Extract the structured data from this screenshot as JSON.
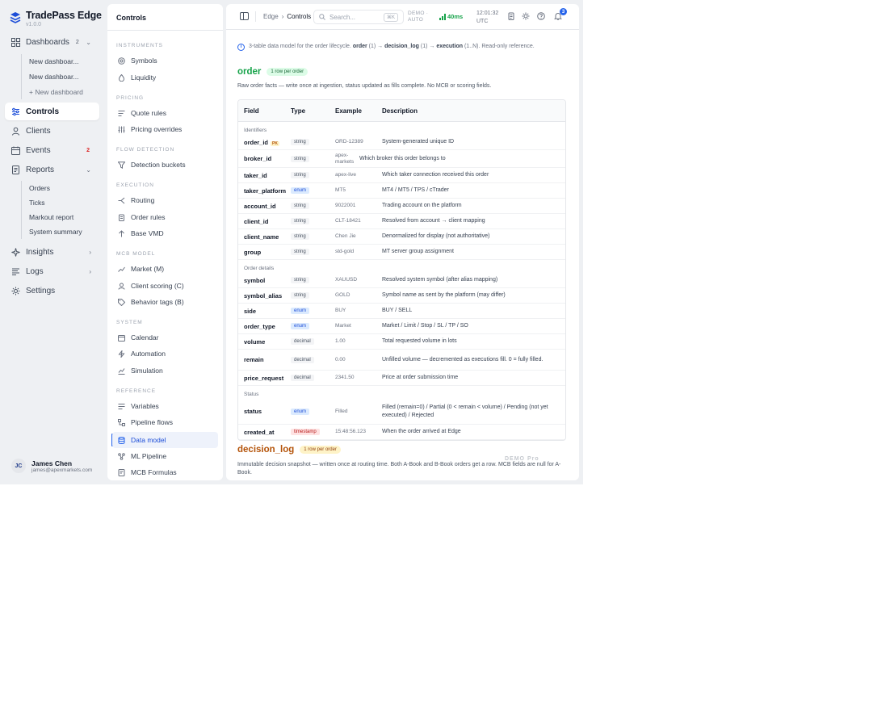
{
  "brand": {
    "name": "TradePass Edge",
    "version": "v1.0.0"
  },
  "sidebar": {
    "dashboards": {
      "label": "Dashboards",
      "count": "2"
    },
    "dashboard_items": [
      "New dashboar...",
      "New dashboar...",
      "+ New dashboard"
    ],
    "controls": {
      "label": "Controls"
    },
    "clients": {
      "label": "Clients"
    },
    "events": {
      "label": "Events",
      "count": "2"
    },
    "reports": {
      "label": "Reports"
    },
    "report_items": [
      "Orders",
      "Ticks",
      "Markout report",
      "System summary"
    ],
    "insights": {
      "label": "Insights"
    },
    "logs": {
      "label": "Logs"
    },
    "settings": {
      "label": "Settings"
    }
  },
  "user": {
    "initials": "JC",
    "name": "James Chen",
    "email": "james@apexmarkets.com"
  },
  "controls_panel": {
    "title": "Controls",
    "sections": {
      "instruments": "INSTRUMENTS",
      "pricing": "PRICING",
      "flow_detection": "FLOW DETECTION",
      "execution": "EXECUTION",
      "mcb_model": "MCB MODEL",
      "system": "SYSTEM",
      "reference": "REFERENCE"
    },
    "items": {
      "symbols": "Symbols",
      "liquidity": "Liquidity",
      "quote_rules": "Quote rules",
      "pricing_overrides": "Pricing overrides",
      "detection_buckets": "Detection buckets",
      "routing": "Routing",
      "order_rules": "Order rules",
      "base_vmd": "Base VMD",
      "market": "Market (M)",
      "client_scoring": "Client scoring (C)",
      "behavior_tags": "Behavior tags (B)",
      "calendar": "Calendar",
      "automation": "Automation",
      "simulation": "Simulation",
      "variables": "Variables",
      "pipeline_flows": "Pipeline flows",
      "data_model": "Data model",
      "ml_pipeline": "ML Pipeline",
      "mcb_formulas": "MCB Formulas"
    }
  },
  "topbar": {
    "crumb_root": "Edge",
    "crumb_sep": "›",
    "crumb_current": "Controls",
    "search_placeholder": "Search...",
    "search_kbd": "⌘K",
    "mode_line1": "DEMO ·",
    "mode_line2": "AUTO",
    "latency": "40ms",
    "time": "12:01:32",
    "timezone": "UTC",
    "notifications": "3"
  },
  "info": {
    "prefix": "3-table data model for the order lifecycle.",
    "t1": "order",
    "t1_card": "(1) →",
    "t2": "decision_log",
    "t2_card": "(1) →",
    "t3": "execution",
    "suffix": "(1..N). Read-only reference."
  },
  "order_section": {
    "title": "order",
    "pill": "1 row per order",
    "description": "Raw order facts — write once at ingestion, status updated as fills complete. No MCB or scoring fields.",
    "headers": {
      "field": "Field",
      "type": "Type",
      "example": "Example",
      "description": "Description"
    },
    "groups": {
      "identifiers": "Identifiers",
      "order_details": "Order details",
      "status": "Status"
    },
    "pk_label": "PK",
    "rows_identifiers": [
      {
        "field": "order_id",
        "type": "string",
        "example": "ORD-12389",
        "desc": "System-generated unique ID"
      },
      {
        "field": "broker_id",
        "type": "string",
        "example": "apex-markets",
        "desc": "Which broker this order belongs to"
      },
      {
        "field": "taker_id",
        "type": "string",
        "example": "apex-live",
        "desc": "Which taker connection received this order"
      },
      {
        "field": "taker_platform",
        "type": "enum",
        "example": "MT5",
        "desc": "MT4 / MT5 / TPS / cTrader"
      },
      {
        "field": "account_id",
        "type": "string",
        "example": "9022001",
        "desc": "Trading account on the platform"
      },
      {
        "field": "client_id",
        "type": "string",
        "example": "CLT-18421",
        "desc": "Resolved from account → client mapping"
      },
      {
        "field": "client_name",
        "type": "string",
        "example": "Chen Jie",
        "desc": "Denormalized for display (not authoritative)"
      },
      {
        "field": "group",
        "type": "string",
        "example": "std-gold",
        "desc": "MT server group assignment"
      }
    ],
    "rows_details": [
      {
        "field": "symbol",
        "type": "string",
        "example": "XAUUSD",
        "desc": "Resolved system symbol (after alias mapping)"
      },
      {
        "field": "symbol_alias",
        "type": "string",
        "example": "GOLD",
        "desc": "Symbol name as sent by the platform (may differ)"
      },
      {
        "field": "side",
        "type": "enum",
        "example": "BUY",
        "desc": "BUY / SELL"
      },
      {
        "field": "order_type",
        "type": "enum",
        "example": "Market",
        "desc": "Market / Limit / Stop / SL / TP / SO"
      },
      {
        "field": "volume",
        "type": "decimal",
        "example": "1.00",
        "desc": "Total requested volume in lots"
      },
      {
        "field": "remain",
        "type": "decimal",
        "example": "0.00",
        "desc": "Unfilled volume — decremented as executions fill. 0 = fully filled."
      },
      {
        "field": "price_request",
        "type": "decimal",
        "example": "2341.50",
        "desc": "Price at order submission time"
      }
    ],
    "rows_status": [
      {
        "field": "status",
        "type": "enum",
        "example": "Filled",
        "desc": "Filled (remain=0) / Partial (0 < remain < volume) / Pending (not yet executed) / Rejected"
      },
      {
        "field": "created_at",
        "type": "timestamp",
        "example": "15:48:56.123",
        "desc": "When the order arrived at Edge"
      }
    ]
  },
  "decision_section": {
    "title": "decision_log",
    "pill": "1 row per order",
    "description": "Immutable decision snapshot — written once at routing time. Both A-Book and B-Book orders get a row. MCB fields are null for A-Book."
  },
  "watermark": "DEMO Pro",
  "colors": {
    "accent": "#2563eb",
    "order_green": "#16a34a",
    "decision_amber": "#b45309",
    "latency_green": "#16a34a"
  }
}
